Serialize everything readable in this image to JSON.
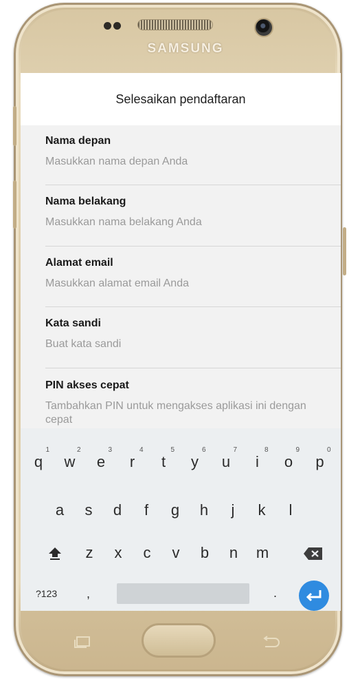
{
  "device": {
    "brand": "SAMSUNG"
  },
  "header": {
    "title": "Selesaikan pendaftaran"
  },
  "form": {
    "fields": [
      {
        "label": "Nama depan",
        "placeholder": "Masukkan nama depan Anda"
      },
      {
        "label": "Nama belakang",
        "placeholder": "Masukkan nama belakang Anda"
      },
      {
        "label": "Alamat email",
        "placeholder": "Masukkan alamat email Anda"
      },
      {
        "label": "Kata sandi",
        "placeholder": "Buat kata sandi"
      },
      {
        "label": "PIN akses cepat",
        "placeholder": "Tambahkan PIN untuk mengakses aplikasi ini dengan cepat"
      }
    ]
  },
  "keyboard": {
    "row1": [
      "q",
      "w",
      "e",
      "r",
      "t",
      "y",
      "u",
      "i",
      "o",
      "p"
    ],
    "row1_hints": [
      "1",
      "2",
      "3",
      "4",
      "5",
      "6",
      "7",
      "8",
      "9",
      "0"
    ],
    "row2": [
      "a",
      "s",
      "d",
      "f",
      "g",
      "h",
      "j",
      "k",
      "l"
    ],
    "row3": [
      "z",
      "x",
      "c",
      "v",
      "b",
      "n",
      "m"
    ],
    "symbols_key": "?123",
    "comma_key": ",",
    "period_key": ".",
    "icons": {
      "shift": "shift-arrow-icon",
      "backspace": "backspace-icon",
      "enter": "enter-return-icon"
    },
    "accent_color": "#2f8be0"
  },
  "navigation": {
    "icons": [
      "recent-apps-icon",
      "home-button",
      "back-icon"
    ]
  }
}
